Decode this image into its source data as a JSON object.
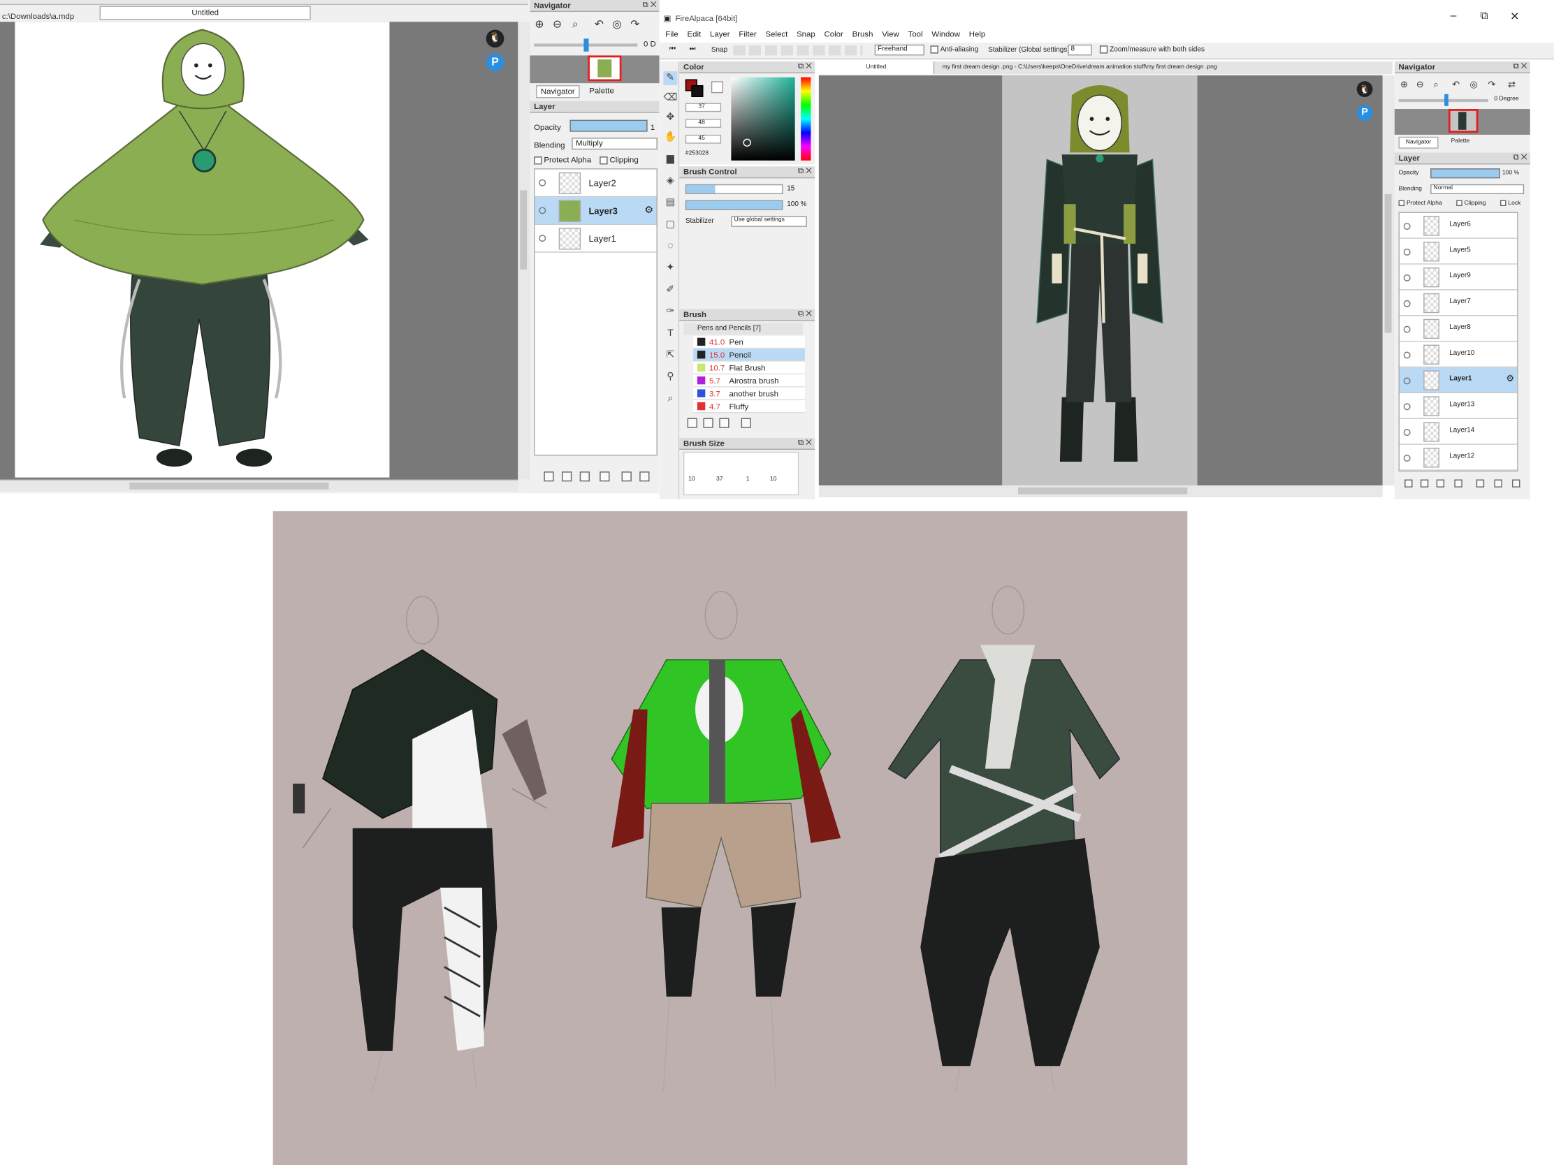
{
  "left_app": {
    "tab_label": "Untitled",
    "path_label": "c:\\Downloads\\a.mdp",
    "navigator": {
      "title": "Navigator",
      "zoom_readout": "0 D",
      "tabs": [
        "Navigator",
        "Palette"
      ]
    },
    "layer_panel": {
      "title": "Layer",
      "opacity_label": "Opacity",
      "opacity_value": "1",
      "blending_label": "Blending",
      "blending_value": "Multiply",
      "protect_alpha_label": "Protect Alpha",
      "clipping_label": "Clipping",
      "layers": [
        {
          "name": "Layer2",
          "selected": false
        },
        {
          "name": "Layer3",
          "selected": true
        },
        {
          "name": "Layer1",
          "selected": false
        }
      ]
    }
  },
  "right_app": {
    "title": "FireAlpaca [64bit]",
    "window_controls": [
      "–",
      "⧉",
      "✕"
    ],
    "menu": [
      "File",
      "Edit",
      "Layer",
      "Filter",
      "Select",
      "Snap",
      "Color",
      "Brush",
      "View",
      "Tool",
      "Window",
      "Help"
    ],
    "toolbar": {
      "snap_label": "Snap",
      "mode_value": "Freehand",
      "antialias_label": "Anti-aliasing",
      "stabilizer_label": "Stabilizer (Global settings)",
      "stabilizer_value": "8",
      "zoom_measure_label": "Zoom/measure with both sides"
    },
    "tabs": [
      "Untitled",
      "my first dream design .png - C:\\Users\\keeps\\OneDrive\\dream animation stuff\\my first dream design .png"
    ],
    "color_panel": {
      "title": "Color",
      "r": "37",
      "g": "48",
      "b": "45",
      "hex": "#253028"
    },
    "brush_control": {
      "title": "Brush Control",
      "size_value": "15",
      "opacity_value": "100 %",
      "stabilizer_label": "Stabilizer",
      "stabilizer_value": "Use global settings"
    },
    "brush_panel": {
      "title": "Brush",
      "category": "Pens and Pencils [7]",
      "brushes": [
        {
          "size": "41.0",
          "name": "Pen",
          "color": "#222222"
        },
        {
          "size": "15.0",
          "name": "Pencil",
          "color": "#222222"
        },
        {
          "size": "10.7",
          "name": "Flat Brush",
          "color": "#c8e670"
        },
        {
          "size": "5.7",
          "name": "Airostra brush",
          "color": "#b020e0"
        },
        {
          "size": "3.7",
          "name": "another brush",
          "color": "#3050e0"
        },
        {
          "size": "4.7",
          "name": "Fluffy",
          "color": "#e03030"
        }
      ]
    },
    "brush_size_panel": {
      "title": "Brush Size",
      "values": [
        "10",
        "37",
        "1",
        "10"
      ]
    },
    "navigator": {
      "title": "Navigator",
      "zoom_readout": "0 Degree",
      "tabs": [
        "Navigator",
        "Palette"
      ]
    },
    "layer_panel": {
      "title": "Layer",
      "opacity_label": "Opacity",
      "opacity_value": "100 %",
      "blending_label": "Blending",
      "blending_value": "Normal",
      "protect_alpha_label": "Protect Alpha",
      "clipping_label": "Clipping",
      "lock_label": "Lock",
      "layers": [
        {
          "name": "Layer6",
          "selected": false
        },
        {
          "name": "Layer5",
          "selected": false
        },
        {
          "name": "Layer9",
          "selected": false
        },
        {
          "name": "Layer7",
          "selected": false
        },
        {
          "name": "Layer8",
          "selected": false
        },
        {
          "name": "Layer10",
          "selected": false
        },
        {
          "name": "Layer1",
          "selected": true
        },
        {
          "name": "Layer13",
          "selected": false
        },
        {
          "name": "Layer14",
          "selected": false
        },
        {
          "name": "Layer12",
          "selected": false
        }
      ]
    }
  },
  "colors": {
    "canvas_bg": "#797979",
    "sketch_bg": "#bfb0b0",
    "accent_select": "#b9d9f5",
    "poncho_green": "#8cae52",
    "dark_green": "#36463c"
  }
}
